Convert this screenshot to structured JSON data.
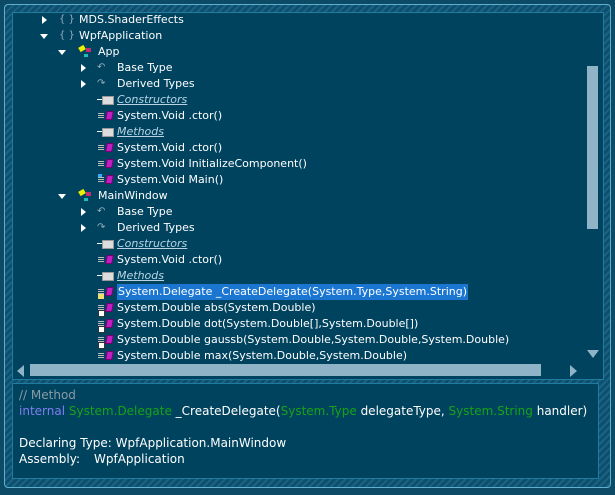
{
  "tree": {
    "rows": [
      {
        "label": "MDS.ShaderEffects",
        "level": 0,
        "expander": "right",
        "icon": "namespace-icon"
      },
      {
        "label": "WpfApplication",
        "level": 0,
        "expander": "down",
        "icon": "namespace-icon"
      },
      {
        "label": "App",
        "level": 1,
        "expander": "down",
        "icon": "class-icon"
      },
      {
        "label": "Base Type",
        "level": 2,
        "expander": "right",
        "icon": "base-type-icon"
      },
      {
        "label": "Derived Types",
        "level": 2,
        "expander": "right",
        "icon": "derived-types-icon"
      },
      {
        "label": "Constructors",
        "level": 2,
        "group": true,
        "icon": "group-icon"
      },
      {
        "label": "System.Void .ctor()",
        "level": 2,
        "icon": "method-icon"
      },
      {
        "label": "Methods",
        "level": 2,
        "group": true,
        "icon": "group-icon"
      },
      {
        "label": "System.Void .ctor()",
        "level": 2,
        "icon": "method-icon"
      },
      {
        "label": "System.Void InitializeComponent()",
        "level": 2,
        "icon": "method-icon"
      },
      {
        "label": "System.Void Main()",
        "level": 2,
        "icon": "static-method-icon"
      },
      {
        "label": "MainWindow",
        "level": 1,
        "expander": "down",
        "icon": "class-icon"
      },
      {
        "label": "Base Type",
        "level": 2,
        "expander": "right",
        "icon": "base-type-icon"
      },
      {
        "label": "Derived Types",
        "level": 2,
        "expander": "right",
        "icon": "derived-types-icon"
      },
      {
        "label": "Constructors",
        "level": 2,
        "group": true,
        "icon": "group-icon"
      },
      {
        "label": "System.Void .ctor()",
        "level": 2,
        "icon": "method-icon"
      },
      {
        "label": "Methods",
        "level": 2,
        "group": true,
        "icon": "group-icon"
      },
      {
        "label": "System.Delegate _CreateDelegate(System.Type,System.String)",
        "level": 2,
        "icon": "internal-method-icon",
        "selected": true
      },
      {
        "label": "System.Double abs(System.Double)",
        "level": 2,
        "icon": "private-method-icon"
      },
      {
        "label": "System.Double dot(System.Double[],System.Double[])",
        "level": 2,
        "icon": "private-method-icon"
      },
      {
        "label": "System.Double gaussb(System.Double,System.Double,System.Double)",
        "level": 2,
        "icon": "private-method-icon"
      },
      {
        "label": "System.Double max(System.Double,System.Double)",
        "level": 2,
        "icon": "method-icon"
      }
    ]
  },
  "details": {
    "comment": "// Method",
    "keyword": "internal",
    "return_type": "System.Delegate",
    "name": " _CreateDelegate(",
    "p1_type": "System.Type",
    "p1_name": " delegateType, ",
    "p2_type": "System.String",
    "p2_name": " handler)",
    "declaring_label": "Declaring Type:",
    "declaring_value": "WpfApplication.MainWindow",
    "assembly_label": "Assembly:",
    "assembly_value": "WpfApplication"
  },
  "colors": {
    "background": "#00435f",
    "selection": "#1b76d1",
    "keyword": "#7e7ef0",
    "type": "#16a316",
    "comment": "#8a9aa3"
  }
}
